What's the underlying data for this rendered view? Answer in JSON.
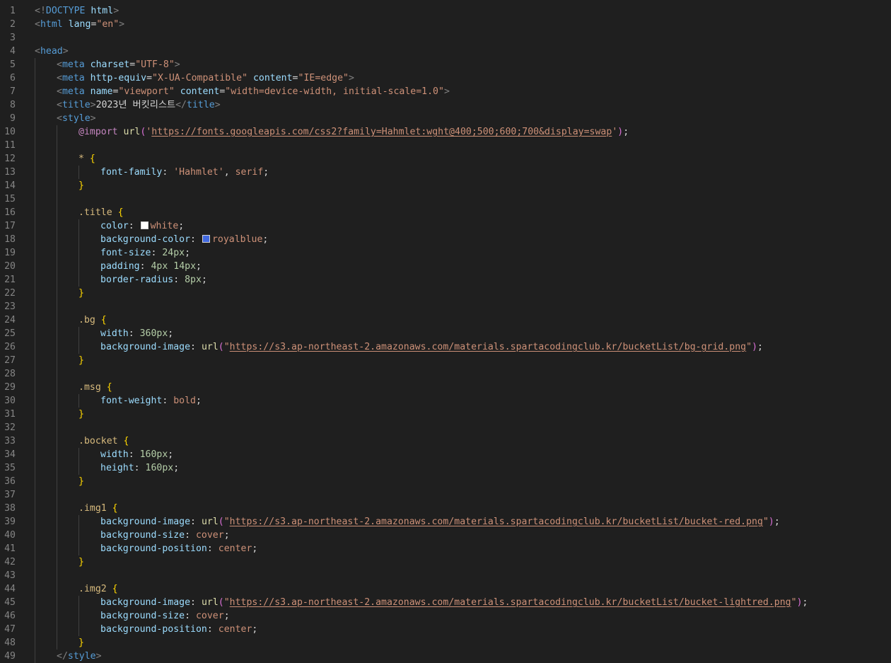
{
  "editor": {
    "lines": [
      {
        "n": "1",
        "indent": 0,
        "tokens": [
          [
            "punct",
            "<!"
          ],
          [
            "tag",
            "DOCTYPE"
          ],
          [
            "text",
            " "
          ],
          [
            "attr",
            "html"
          ],
          [
            "punct",
            ">"
          ]
        ]
      },
      {
        "n": "2",
        "indent": 0,
        "tokens": [
          [
            "punct",
            "<"
          ],
          [
            "tag",
            "html"
          ],
          [
            "text",
            " "
          ],
          [
            "attr",
            "lang"
          ],
          [
            "text",
            "="
          ],
          [
            "str",
            "\"en\""
          ],
          [
            "punct",
            ">"
          ]
        ]
      },
      {
        "n": "3",
        "indent": 0,
        "tokens": []
      },
      {
        "n": "4",
        "indent": 0,
        "tokens": [
          [
            "punct",
            "<"
          ],
          [
            "tag",
            "head"
          ],
          [
            "punct",
            ">"
          ]
        ]
      },
      {
        "n": "5",
        "indent": 1,
        "tokens": [
          [
            "punct",
            "<"
          ],
          [
            "tag",
            "meta"
          ],
          [
            "text",
            " "
          ],
          [
            "attr",
            "charset"
          ],
          [
            "text",
            "="
          ],
          [
            "str",
            "\"UTF-8\""
          ],
          [
            "punct",
            ">"
          ]
        ]
      },
      {
        "n": "6",
        "indent": 1,
        "tokens": [
          [
            "punct",
            "<"
          ],
          [
            "tag",
            "meta"
          ],
          [
            "text",
            " "
          ],
          [
            "attr",
            "http-equiv"
          ],
          [
            "text",
            "="
          ],
          [
            "str",
            "\"X-UA-Compatible\""
          ],
          [
            "text",
            " "
          ],
          [
            "attr",
            "content"
          ],
          [
            "text",
            "="
          ],
          [
            "str",
            "\"IE=edge\""
          ],
          [
            "punct",
            ">"
          ]
        ]
      },
      {
        "n": "7",
        "indent": 1,
        "tokens": [
          [
            "punct",
            "<"
          ],
          [
            "tag",
            "meta"
          ],
          [
            "text",
            " "
          ],
          [
            "attr",
            "name"
          ],
          [
            "text",
            "="
          ],
          [
            "str",
            "\"viewport\""
          ],
          [
            "text",
            " "
          ],
          [
            "attr",
            "content"
          ],
          [
            "text",
            "="
          ],
          [
            "str",
            "\"width=device-width, initial-scale=1.0\""
          ],
          [
            "punct",
            ">"
          ]
        ]
      },
      {
        "n": "8",
        "indent": 1,
        "tokens": [
          [
            "punct",
            "<"
          ],
          [
            "tag",
            "title"
          ],
          [
            "punct",
            ">"
          ],
          [
            "text",
            "2023년 버킷리스트"
          ],
          [
            "punct",
            "</"
          ],
          [
            "tag",
            "title"
          ],
          [
            "punct",
            ">"
          ]
        ]
      },
      {
        "n": "9",
        "indent": 1,
        "tokens": [
          [
            "punct",
            "<"
          ],
          [
            "tag",
            "style"
          ],
          [
            "punct",
            ">"
          ]
        ]
      },
      {
        "n": "10",
        "indent": 2,
        "tokens": [
          [
            "at",
            "@import"
          ],
          [
            "text",
            " "
          ],
          [
            "fn",
            "url"
          ],
          [
            "paren",
            "("
          ],
          [
            "str",
            "'"
          ],
          [
            "url",
            "https://fonts.googleapis.com/css2?family=Hahmlet:wght@400;500;600;700&display=swap"
          ],
          [
            "str",
            "'"
          ],
          [
            "paren",
            ")"
          ],
          [
            "text",
            ";"
          ]
        ]
      },
      {
        "n": "11",
        "indent": 2,
        "tokens": []
      },
      {
        "n": "12",
        "indent": 2,
        "tokens": [
          [
            "sel",
            "*"
          ],
          [
            "text",
            " "
          ],
          [
            "brace",
            "{"
          ]
        ]
      },
      {
        "n": "13",
        "indent": 3,
        "tokens": [
          [
            "prop",
            "font-family"
          ],
          [
            "text",
            ": "
          ],
          [
            "str",
            "'Hahmlet'"
          ],
          [
            "text",
            ", "
          ],
          [
            "val",
            "serif"
          ],
          [
            "text",
            ";"
          ]
        ]
      },
      {
        "n": "14",
        "indent": 2,
        "tokens": [
          [
            "brace",
            "}"
          ]
        ]
      },
      {
        "n": "15",
        "indent": 2,
        "tokens": []
      },
      {
        "n": "16",
        "indent": 2,
        "tokens": [
          [
            "sel",
            ".title"
          ],
          [
            "text",
            " "
          ],
          [
            "brace",
            "{"
          ]
        ]
      },
      {
        "n": "17",
        "indent": 3,
        "tokens": [
          [
            "prop",
            "color"
          ],
          [
            "text",
            ": "
          ],
          [
            "swatch",
            "#ffffff"
          ],
          [
            "val",
            "white"
          ],
          [
            "text",
            ";"
          ]
        ]
      },
      {
        "n": "18",
        "indent": 3,
        "tokens": [
          [
            "prop",
            "background-color"
          ],
          [
            "text",
            ": "
          ],
          [
            "swatch",
            "#4169e1"
          ],
          [
            "val",
            "royalblue"
          ],
          [
            "text",
            ";"
          ]
        ]
      },
      {
        "n": "19",
        "indent": 3,
        "tokens": [
          [
            "prop",
            "font-size"
          ],
          [
            "text",
            ": "
          ],
          [
            "num",
            "24px"
          ],
          [
            "text",
            ";"
          ]
        ]
      },
      {
        "n": "20",
        "indent": 3,
        "tokens": [
          [
            "prop",
            "padding"
          ],
          [
            "text",
            ": "
          ],
          [
            "num",
            "4px"
          ],
          [
            "text",
            " "
          ],
          [
            "num",
            "14px"
          ],
          [
            "text",
            ";"
          ]
        ]
      },
      {
        "n": "21",
        "indent": 3,
        "tokens": [
          [
            "prop",
            "border-radius"
          ],
          [
            "text",
            ": "
          ],
          [
            "num",
            "8px"
          ],
          [
            "text",
            ";"
          ]
        ]
      },
      {
        "n": "22",
        "indent": 2,
        "tokens": [
          [
            "brace",
            "}"
          ]
        ]
      },
      {
        "n": "23",
        "indent": 2,
        "tokens": []
      },
      {
        "n": "24",
        "indent": 2,
        "tokens": [
          [
            "sel",
            ".bg"
          ],
          [
            "text",
            " "
          ],
          [
            "brace",
            "{"
          ]
        ]
      },
      {
        "n": "25",
        "indent": 3,
        "tokens": [
          [
            "prop",
            "width"
          ],
          [
            "text",
            ": "
          ],
          [
            "num",
            "360px"
          ],
          [
            "text",
            ";"
          ]
        ]
      },
      {
        "n": "26",
        "indent": 3,
        "tokens": [
          [
            "prop",
            "background-image"
          ],
          [
            "text",
            ": "
          ],
          [
            "fn",
            "url"
          ],
          [
            "paren",
            "("
          ],
          [
            "str",
            "\""
          ],
          [
            "url",
            "https://s3.ap-northeast-2.amazonaws.com/materials.spartacodingclub.kr/bucketList/bg-grid.png"
          ],
          [
            "str",
            "\""
          ],
          [
            "paren",
            ")"
          ],
          [
            "text",
            ";"
          ]
        ]
      },
      {
        "n": "27",
        "indent": 2,
        "tokens": [
          [
            "brace",
            "}"
          ]
        ]
      },
      {
        "n": "28",
        "indent": 2,
        "tokens": []
      },
      {
        "n": "29",
        "indent": 2,
        "tokens": [
          [
            "sel",
            ".msg"
          ],
          [
            "text",
            " "
          ],
          [
            "brace",
            "{"
          ]
        ]
      },
      {
        "n": "30",
        "indent": 3,
        "tokens": [
          [
            "prop",
            "font-weight"
          ],
          [
            "text",
            ": "
          ],
          [
            "val",
            "bold"
          ],
          [
            "text",
            ";"
          ]
        ]
      },
      {
        "n": "31",
        "indent": 2,
        "tokens": [
          [
            "brace",
            "}"
          ]
        ]
      },
      {
        "n": "32",
        "indent": 2,
        "tokens": []
      },
      {
        "n": "33",
        "indent": 2,
        "tokens": [
          [
            "sel",
            ".bocket"
          ],
          [
            "text",
            " "
          ],
          [
            "brace",
            "{"
          ]
        ]
      },
      {
        "n": "34",
        "indent": 3,
        "tokens": [
          [
            "prop",
            "width"
          ],
          [
            "text",
            ": "
          ],
          [
            "num",
            "160px"
          ],
          [
            "text",
            ";"
          ]
        ]
      },
      {
        "n": "35",
        "indent": 3,
        "tokens": [
          [
            "prop",
            "height"
          ],
          [
            "text",
            ": "
          ],
          [
            "num",
            "160px"
          ],
          [
            "text",
            ";"
          ]
        ]
      },
      {
        "n": "36",
        "indent": 2,
        "tokens": [
          [
            "brace",
            "}"
          ]
        ]
      },
      {
        "n": "37",
        "indent": 2,
        "tokens": []
      },
      {
        "n": "38",
        "indent": 2,
        "tokens": [
          [
            "sel",
            ".img1"
          ],
          [
            "text",
            " "
          ],
          [
            "brace",
            "{"
          ]
        ]
      },
      {
        "n": "39",
        "indent": 3,
        "tokens": [
          [
            "prop",
            "background-image"
          ],
          [
            "text",
            ": "
          ],
          [
            "fn",
            "url"
          ],
          [
            "paren",
            "("
          ],
          [
            "str",
            "\""
          ],
          [
            "url",
            "https://s3.ap-northeast-2.amazonaws.com/materials.spartacodingclub.kr/bucketList/bucket-red.png"
          ],
          [
            "str",
            "\""
          ],
          [
            "paren",
            ")"
          ],
          [
            "text",
            ";"
          ]
        ]
      },
      {
        "n": "40",
        "indent": 3,
        "tokens": [
          [
            "prop",
            "background-size"
          ],
          [
            "text",
            ": "
          ],
          [
            "val",
            "cover"
          ],
          [
            "text",
            ";"
          ]
        ]
      },
      {
        "n": "41",
        "indent": 3,
        "tokens": [
          [
            "prop",
            "background-position"
          ],
          [
            "text",
            ": "
          ],
          [
            "val",
            "center"
          ],
          [
            "text",
            ";"
          ]
        ]
      },
      {
        "n": "42",
        "indent": 2,
        "tokens": [
          [
            "brace",
            "}"
          ]
        ]
      },
      {
        "n": "43",
        "indent": 2,
        "tokens": []
      },
      {
        "n": "44",
        "indent": 2,
        "tokens": [
          [
            "sel",
            ".img2"
          ],
          [
            "text",
            " "
          ],
          [
            "brace",
            "{"
          ]
        ]
      },
      {
        "n": "45",
        "indent": 3,
        "tokens": [
          [
            "prop",
            "background-image"
          ],
          [
            "text",
            ": "
          ],
          [
            "fn",
            "url"
          ],
          [
            "paren",
            "("
          ],
          [
            "str",
            "\""
          ],
          [
            "url",
            "https://s3.ap-northeast-2.amazonaws.com/materials.spartacodingclub.kr/bucketList/bucket-lightred.png"
          ],
          [
            "str",
            "\""
          ],
          [
            "paren",
            ")"
          ],
          [
            "text",
            ";"
          ]
        ]
      },
      {
        "n": "46",
        "indent": 3,
        "tokens": [
          [
            "prop",
            "background-size"
          ],
          [
            "text",
            ": "
          ],
          [
            "val",
            "cover"
          ],
          [
            "text",
            ";"
          ]
        ]
      },
      {
        "n": "47",
        "indent": 3,
        "tokens": [
          [
            "prop",
            "background-position"
          ],
          [
            "text",
            ": "
          ],
          [
            "val",
            "center"
          ],
          [
            "text",
            ";"
          ]
        ]
      },
      {
        "n": "48",
        "indent": 2,
        "tokens": [
          [
            "brace",
            "}"
          ]
        ]
      },
      {
        "n": "49",
        "indent": 1,
        "tokens": [
          [
            "punct",
            "</"
          ],
          [
            "tag",
            "style"
          ],
          [
            "punct",
            ">"
          ]
        ]
      }
    ]
  }
}
